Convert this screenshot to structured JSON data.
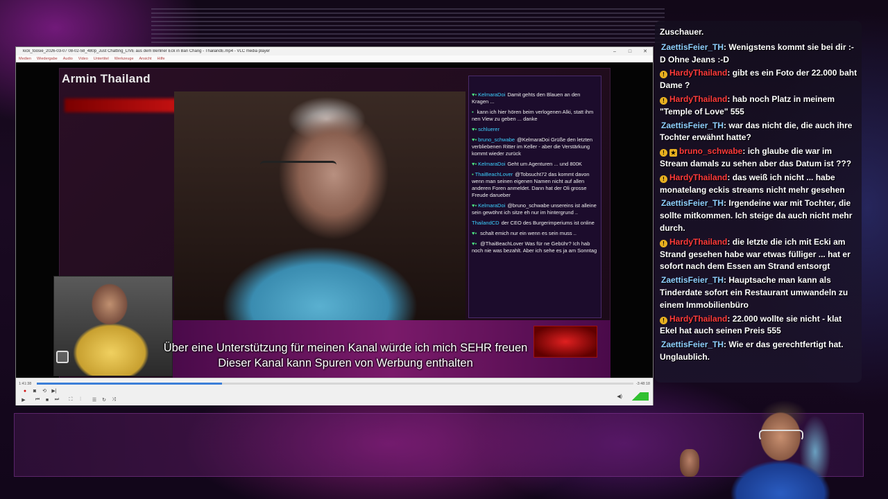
{
  "vlc": {
    "title": "kick_toosie_2026-03-07 08-02-58_480p_Just Chatting_LIVE aus dem Berliner Eck in Ban Chang - ThailandE.mp4 - VLC media player",
    "menu": [
      "Medien",
      "Wiedergabe",
      "Audio",
      "Video",
      "Untertitel",
      "Werkzeuge",
      "Ansicht",
      "Hilfe"
    ],
    "time_elapsed": "1:41:38",
    "time_remaining": "-3:48:18",
    "progress_fraction": 0.31
  },
  "video": {
    "channel_label": "Armin Thailand",
    "subtitle_line1": "Über eine Unterstützung für meinen Kanal würde ich mich SEHR freuen",
    "subtitle_line2": "Dieser Kanal kann Spuren von Werbung enthalten",
    "inner_chat": [
      {
        "name": "KelmaraDoi",
        "text": "Damit gehts den Blauen an den Kragen ..."
      },
      {
        "name": "",
        "text": "kann ich hier hören beim verlogenen Alki, statt ihm nen View zu geben ... danke"
      },
      {
        "name": "schluerer",
        "text": ""
      },
      {
        "name": "bruno_schwabe",
        "text": "@KelmaraDoi Grüße den letzten verbliebenen Ritter im Keller - aber die Verstärkung kommt wieder zurück"
      },
      {
        "name": "KelmaraDoi",
        "text": "Geht um Agenturen ... und 800K"
      },
      {
        "name": "ThaiBeachLover",
        "text": "@Tobsucht72 das kommt davon wenn man seinen eigenen Namen nicht auf allen anderen Foren anmeldet. Dann hat der Oli grosse Freude darueber"
      },
      {
        "name": "KelmaraDoi",
        "text": "@bruno_schwabe unsereins ist alleine sein gewöhnt ich sitze eh nur im hintergrund .."
      },
      {
        "name": "ThailandCD",
        "text": "der CEO des Burgerimperiums ist online"
      },
      {
        "name": "",
        "text": "schalt emich nur ein wenn es sein muss .."
      },
      {
        "name": "",
        "text": "@ThaiBeachLover Was für ne Gebühr? Ich hab noch nie was bezahlt. Aber ich sehe es ja am Sonntag"
      }
    ]
  },
  "chat": {
    "header": "Zuschauer.",
    "messages": [
      {
        "user": "ZaettisFeier_TH",
        "type": "zaettis",
        "badge": "",
        "text": ": Wenigstens kommt sie bei dir :-D Ohne Jeans :-D"
      },
      {
        "user": "HardyThailand",
        "type": "hardy",
        "badge": "!",
        "text": ": gibt es ein Foto der 22.000 baht Dame ?"
      },
      {
        "user": "HardyThailand",
        "type": "hardy",
        "badge": "!",
        "text": ": hab noch Platz in meinem \"Temple of Love\" 555"
      },
      {
        "user": "ZaettisFeier_TH",
        "type": "zaettis",
        "badge": "",
        "text": ": war das nicht die, die auch ihre Tochter erwähnt hatte?"
      },
      {
        "user": "bruno_schwabe",
        "type": "bruno",
        "badge": "!",
        "text": ": ich glaube die war im Stream damals zu sehen aber das Datum ist ???"
      },
      {
        "user": "HardyThailand",
        "type": "hardy",
        "badge": "!",
        "text": ": das weiß ich nicht ... habe monatelang eckis streams nicht mehr gesehen"
      },
      {
        "user": "ZaettisFeier_TH",
        "type": "zaettis",
        "badge": "",
        "text": ": Irgendeine war mit Tochter, die sollte mitkommen. Ich steige da auch nicht mehr durch."
      },
      {
        "user": "HardyThailand",
        "type": "hardy",
        "badge": "!",
        "text": ": die letzte die ich mit Ecki am Strand gesehen habe war etwas fülliger ... hat er sofort nach dem Essen am Strand entsorgt"
      },
      {
        "user": "ZaettisFeier_TH",
        "type": "zaettis",
        "badge": "",
        "text": ": Hauptsache man kann als Tinderdate sofort ein Restaurant umwandeln zu einem Immobilienbüro"
      },
      {
        "user": "HardyThailand",
        "type": "hardy",
        "badge": "!",
        "text": ": 22.000 wollte sie nicht - klat Ekel hat auch seinen Preis 555"
      },
      {
        "user": "ZaettisFeier_TH",
        "type": "zaettis",
        "badge": "",
        "text": ": Wie er das gerechtfertigt hat. Unglaublich."
      }
    ]
  }
}
